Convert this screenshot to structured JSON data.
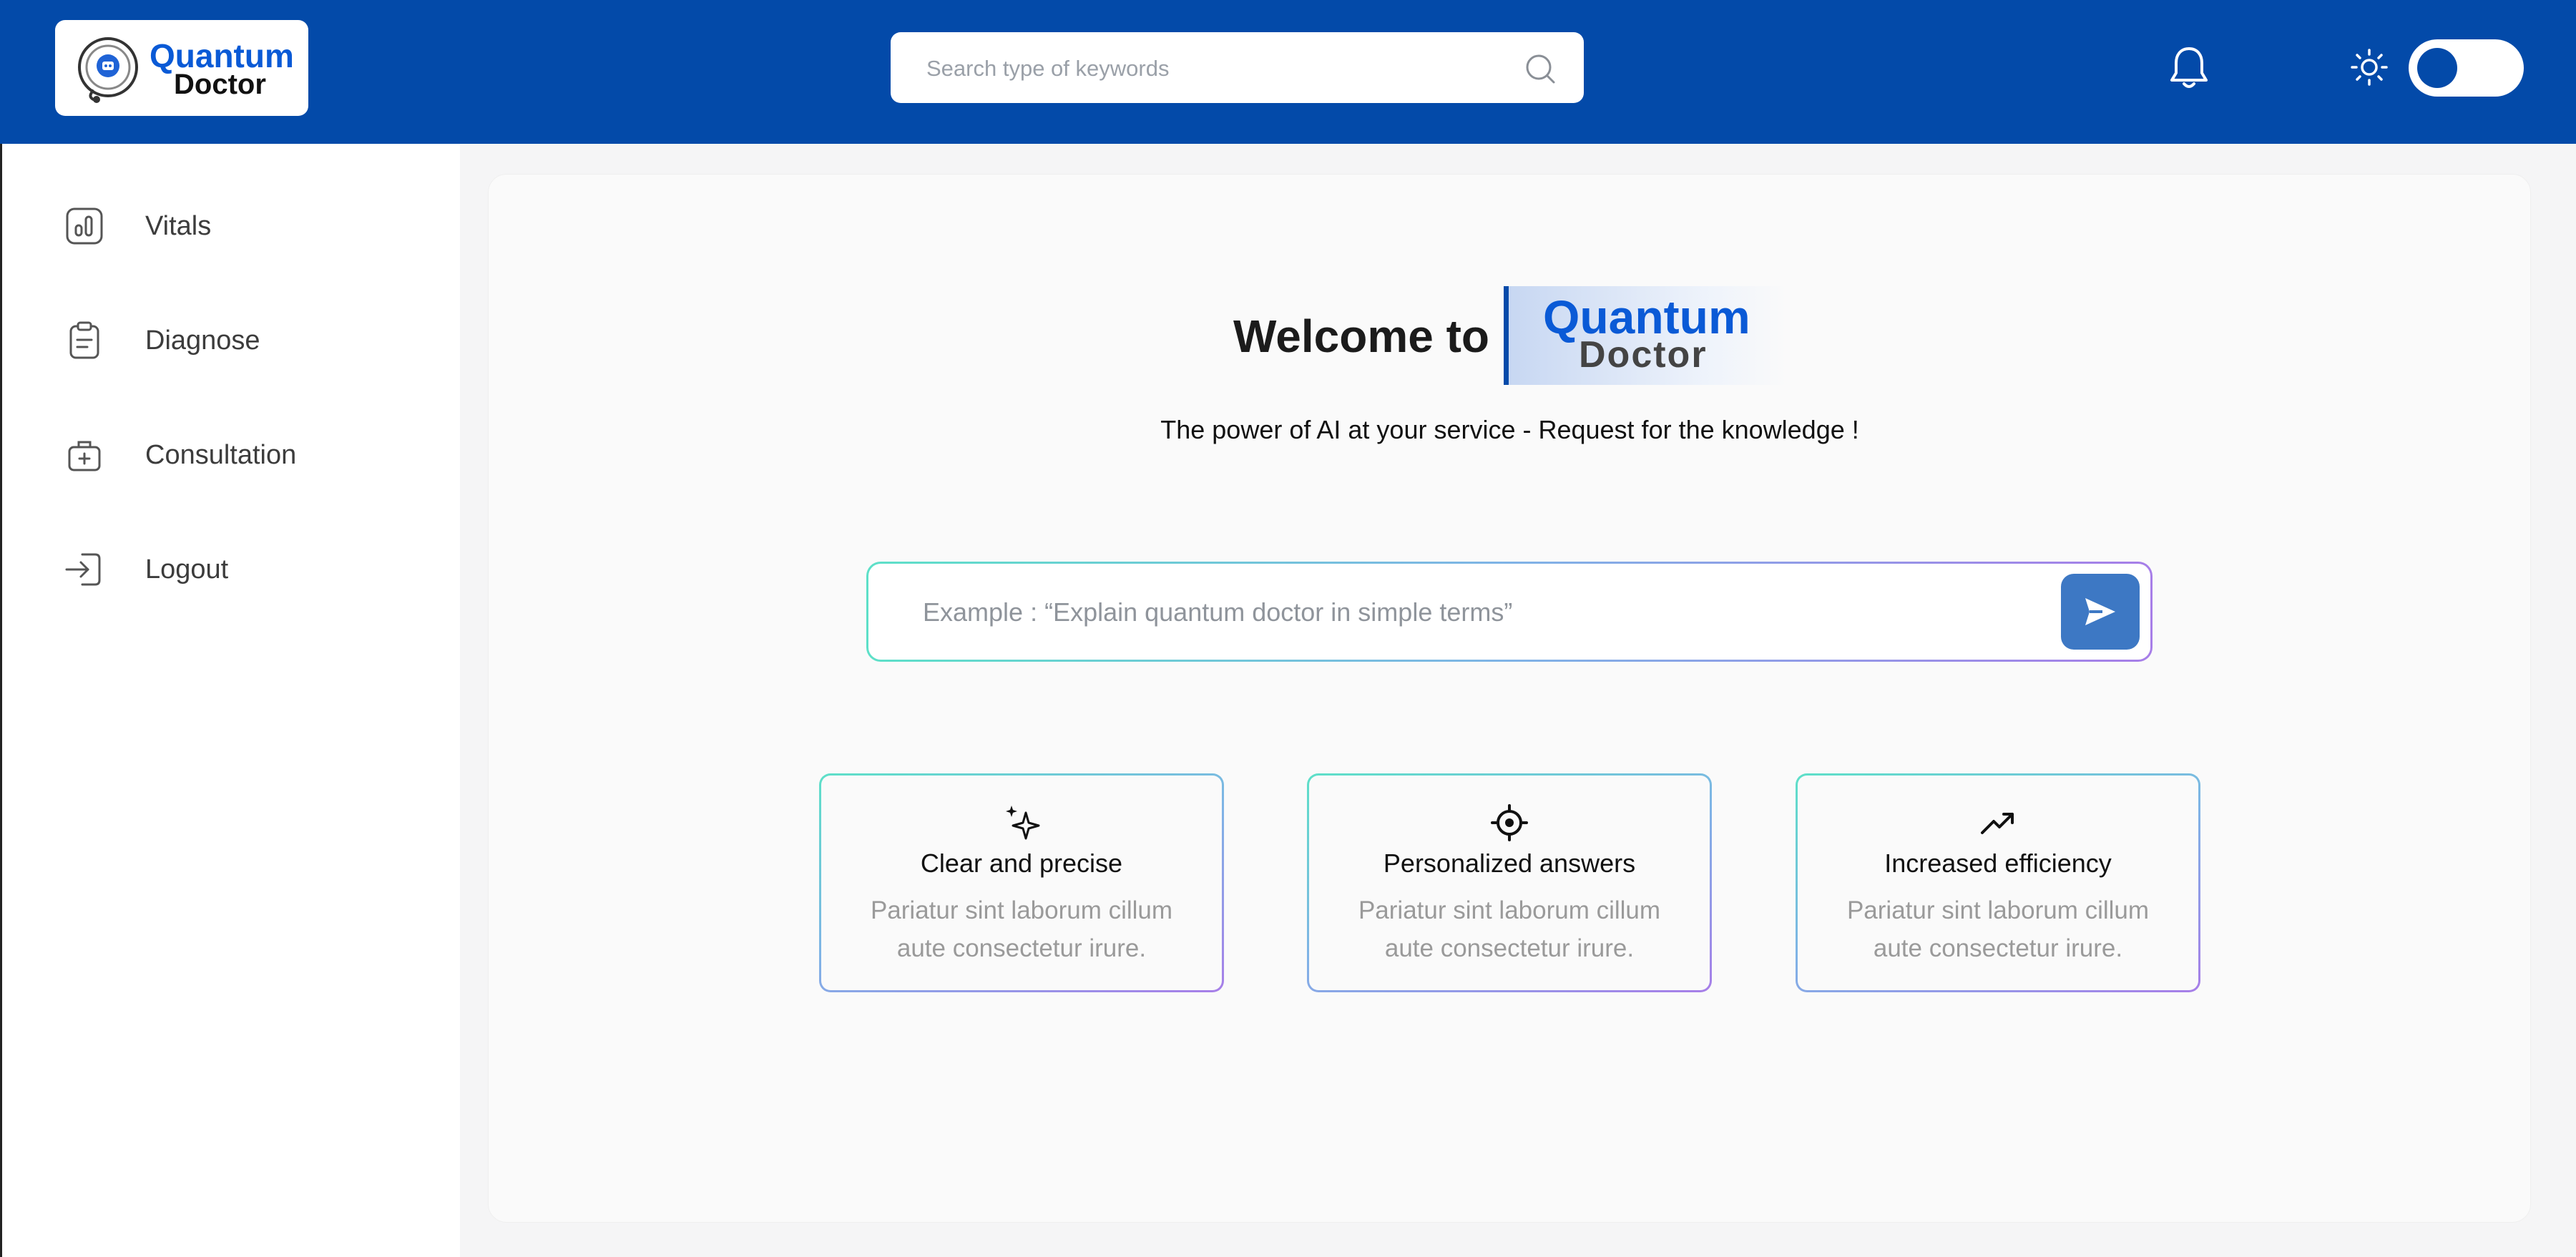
{
  "header": {
    "logo": {
      "line1": "Quantum",
      "line2": "Doctor"
    },
    "search": {
      "placeholder": "Search type of keywords"
    },
    "icons": [
      "search-icon",
      "bell-icon",
      "sun-icon"
    ],
    "theme_toggle": {
      "state": "off"
    }
  },
  "sidebar": {
    "items": [
      {
        "label": "Vitals",
        "icon": "chart-bars-icon"
      },
      {
        "label": "Diagnose",
        "icon": "clipboard-icon"
      },
      {
        "label": "Consultation",
        "icon": "medical-kit-icon"
      },
      {
        "label": "Logout",
        "icon": "logout-icon"
      }
    ]
  },
  "main": {
    "welcome": "Welcome to",
    "brand": {
      "line1": "Quantum",
      "line2": "Doctor"
    },
    "subtitle": "The power of AI at your service - Request for the knowledge !",
    "prompt": {
      "placeholder": "Example : “Explain quantum doctor in simple terms”",
      "send_icon": "send-icon"
    },
    "cards": [
      {
        "icon": "sparkles-icon",
        "title": "Clear and precise",
        "desc": "Pariatur sint laborum cillum aute consectetur irure."
      },
      {
        "icon": "target-icon",
        "title": "Personalized answers",
        "desc": "Pariatur sint laborum cillum aute consectetur irure."
      },
      {
        "icon": "trending-up-icon",
        "title": "Increased efficiency",
        "desc": "Pariatur sint laborum cillum aute consectetur irure."
      }
    ]
  },
  "colors": {
    "brand_blue": "#034aa9",
    "send_button": "#3d78c4",
    "logo_text_blue": "#0a5ad6"
  }
}
